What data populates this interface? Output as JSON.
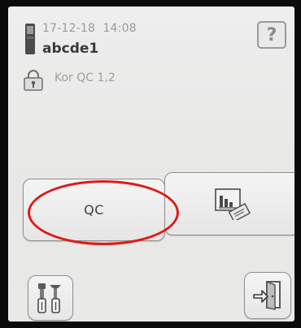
{
  "status": {
    "datetime": "17-12-18  14:08",
    "device_name": "abcde1",
    "qc_status": "Kor QC 1,2"
  },
  "header": {
    "help_label": "?"
  },
  "buttons": {
    "qc_label": "QC"
  },
  "icons": {
    "device": "device-icon",
    "lock": "lock-icon",
    "report": "report-chart-icon",
    "tools": "tools-icon",
    "exit": "exit-door-icon"
  },
  "colors": {
    "highlight_ring": "#e01818",
    "screen_bg": "#eeeeee"
  }
}
